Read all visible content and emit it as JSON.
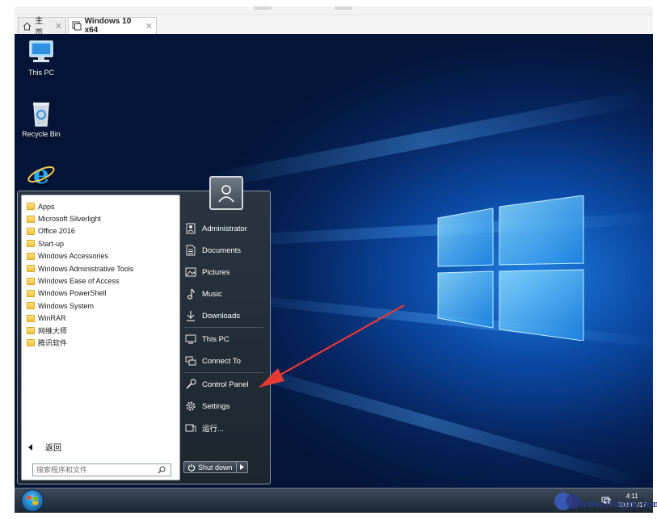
{
  "tabs": [
    {
      "label": "主页",
      "icon": "home-icon",
      "active": false
    },
    {
      "label": "Windows 10 x64",
      "icon": "vm-icon",
      "active": true
    }
  ],
  "desktop": {
    "icons": [
      {
        "label": "This PC",
        "icon": "computer-icon"
      },
      {
        "label": "Recycle Bin",
        "icon": "recycle-bin-icon"
      },
      {
        "label": "",
        "icon": "internet-explorer-icon"
      }
    ]
  },
  "start_menu": {
    "programs": [
      "Apps",
      "Microsoft Silverlight",
      "Office 2016",
      "Start-up",
      "Windows Accessories",
      "Windows Administrative Tools",
      "Windows Ease of Access",
      "Windows PowerShell",
      "Windows System",
      "WinRAR",
      "网维大师",
      "腾讯软件"
    ],
    "back_label": "返回",
    "search_placeholder": "搜索程序和文件",
    "right_items": [
      {
        "label": "Administrator",
        "icon": "user-folder-icon"
      },
      {
        "label": "Documents",
        "icon": "documents-icon"
      },
      {
        "label": "Pictures",
        "icon": "pictures-icon"
      },
      {
        "label": "Music",
        "icon": "music-icon"
      },
      {
        "label": "Downloads",
        "icon": "downloads-icon"
      },
      {
        "label": "This PC",
        "icon": "this-pc-icon"
      },
      {
        "label": "Connect To",
        "icon": "connect-to-icon"
      },
      {
        "label": "Control Panel",
        "icon": "control-panel-icon"
      },
      {
        "label": "Settings",
        "icon": "settings-gear-icon"
      },
      {
        "label": "运行...",
        "icon": "run-icon"
      }
    ],
    "shutdown_label": "Shut down"
  },
  "taskbar": {
    "clock_time": "4:11",
    "clock_date": "2020/1/17"
  },
  "annotation": {
    "color": "#e53935",
    "target": "Control Panel"
  },
  "colors": {
    "accent": "#1f7fe0",
    "arrow": "#e53935"
  }
}
